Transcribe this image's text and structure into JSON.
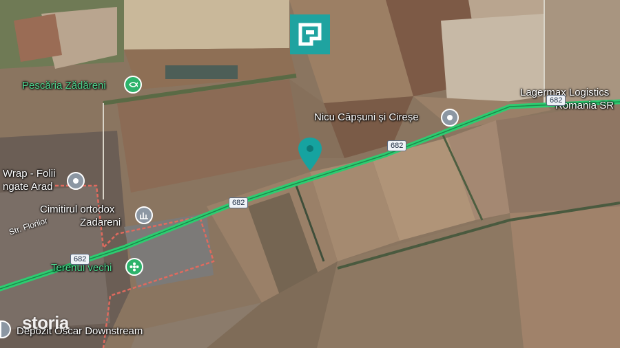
{
  "map": {
    "route_color": "#2ecc71",
    "route_number": "682",
    "pin_color": "#16a3a0"
  },
  "pois": {
    "pescaria": "Pescăria Zădăreni",
    "nicu": "Nicu Căpșuni și Cireșe",
    "lagermax_line1": "Lagermax Logistics",
    "lagermax_line2": "Romania SR",
    "wrap_line1": "Wrap - Folii",
    "wrap_line2": "ngate Arad",
    "cimitirul_line1": "Cimitirul ortodox",
    "cimitirul_line2": "Zadareni",
    "terenul": "Terenul vechi",
    "depozit": "Depozit Oscar Downstream"
  },
  "streets": {
    "florilor": "Str. Florilor"
  },
  "icons": {
    "pescaria": "fish-icon",
    "nicu": "location-dot-icon",
    "wrap": "location-dot-icon",
    "cimitirul": "cemetery-icon",
    "terenul": "park-icon",
    "marker": "map-marker-icon",
    "logo": "brand-logo-icon"
  },
  "watermark": "storia"
}
